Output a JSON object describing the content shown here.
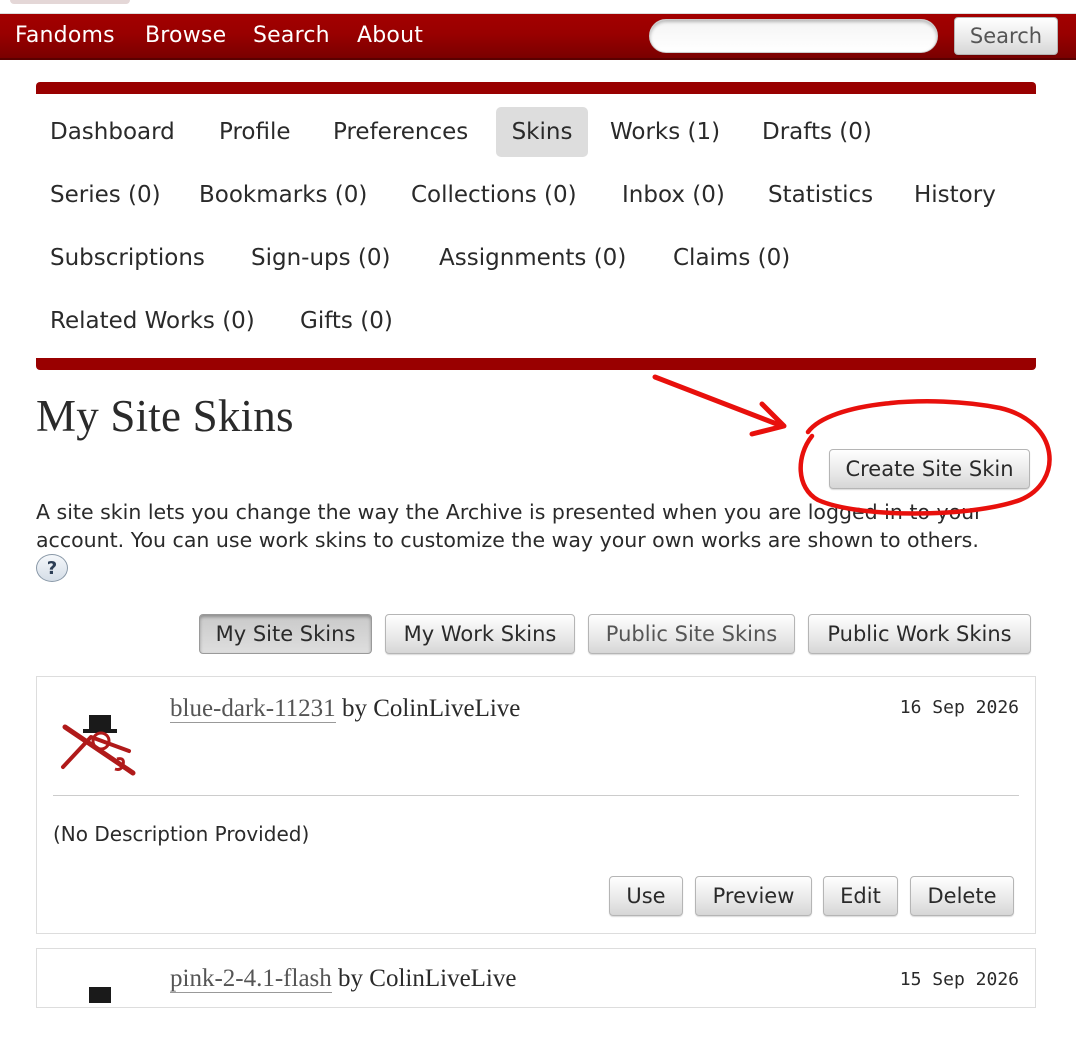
{
  "nav": {
    "items": [
      "Fandoms",
      "Browse",
      "Search",
      "About"
    ],
    "search_placeholder": "",
    "search_button": "Search"
  },
  "dashboard": {
    "items": [
      "Dashboard",
      "Profile",
      "Preferences",
      "Skins",
      "Works (1)",
      "Drafts (0)",
      "Series (0)",
      "Bookmarks (0)",
      "Collections (0)",
      "Inbox (0)",
      "Statistics",
      "History",
      "Subscriptions",
      "Sign-ups (0)",
      "Assignments (0)",
      "Claims (0)",
      "Related Works (0)",
      "Gifts (0)"
    ],
    "current": "Skins"
  },
  "page": {
    "title": "My Site Skins",
    "create_button": "Create Site Skin",
    "intro": "A site skin lets you change the way the Archive is presented when you are logged in to your account. You can use work skins to customize the way your own works are shown to others.",
    "help": "?"
  },
  "skin_tabs": [
    "My Site Skins",
    "My Work Skins",
    "Public Site Skins",
    "Public Work Skins"
  ],
  "skins": [
    {
      "name": "blue-dark-11231",
      "by": "by",
      "author": "ColinLiveLive",
      "date": "16 Sep 2026",
      "description": "(No Description Provided)",
      "actions": [
        "Use",
        "Preview",
        "Edit",
        "Delete"
      ]
    },
    {
      "name": "pink-2-4.1-flash",
      "by": "by",
      "author": "ColinLiveLive",
      "date": "15 Sep 2026"
    }
  ],
  "colors": {
    "brand": "#990000",
    "annotation": "#e8100c",
    "text": "#2a2a2a"
  },
  "icons": [
    "skin-preview-icon",
    "red-arrow-annotation",
    "red-circle-annotation"
  ]
}
